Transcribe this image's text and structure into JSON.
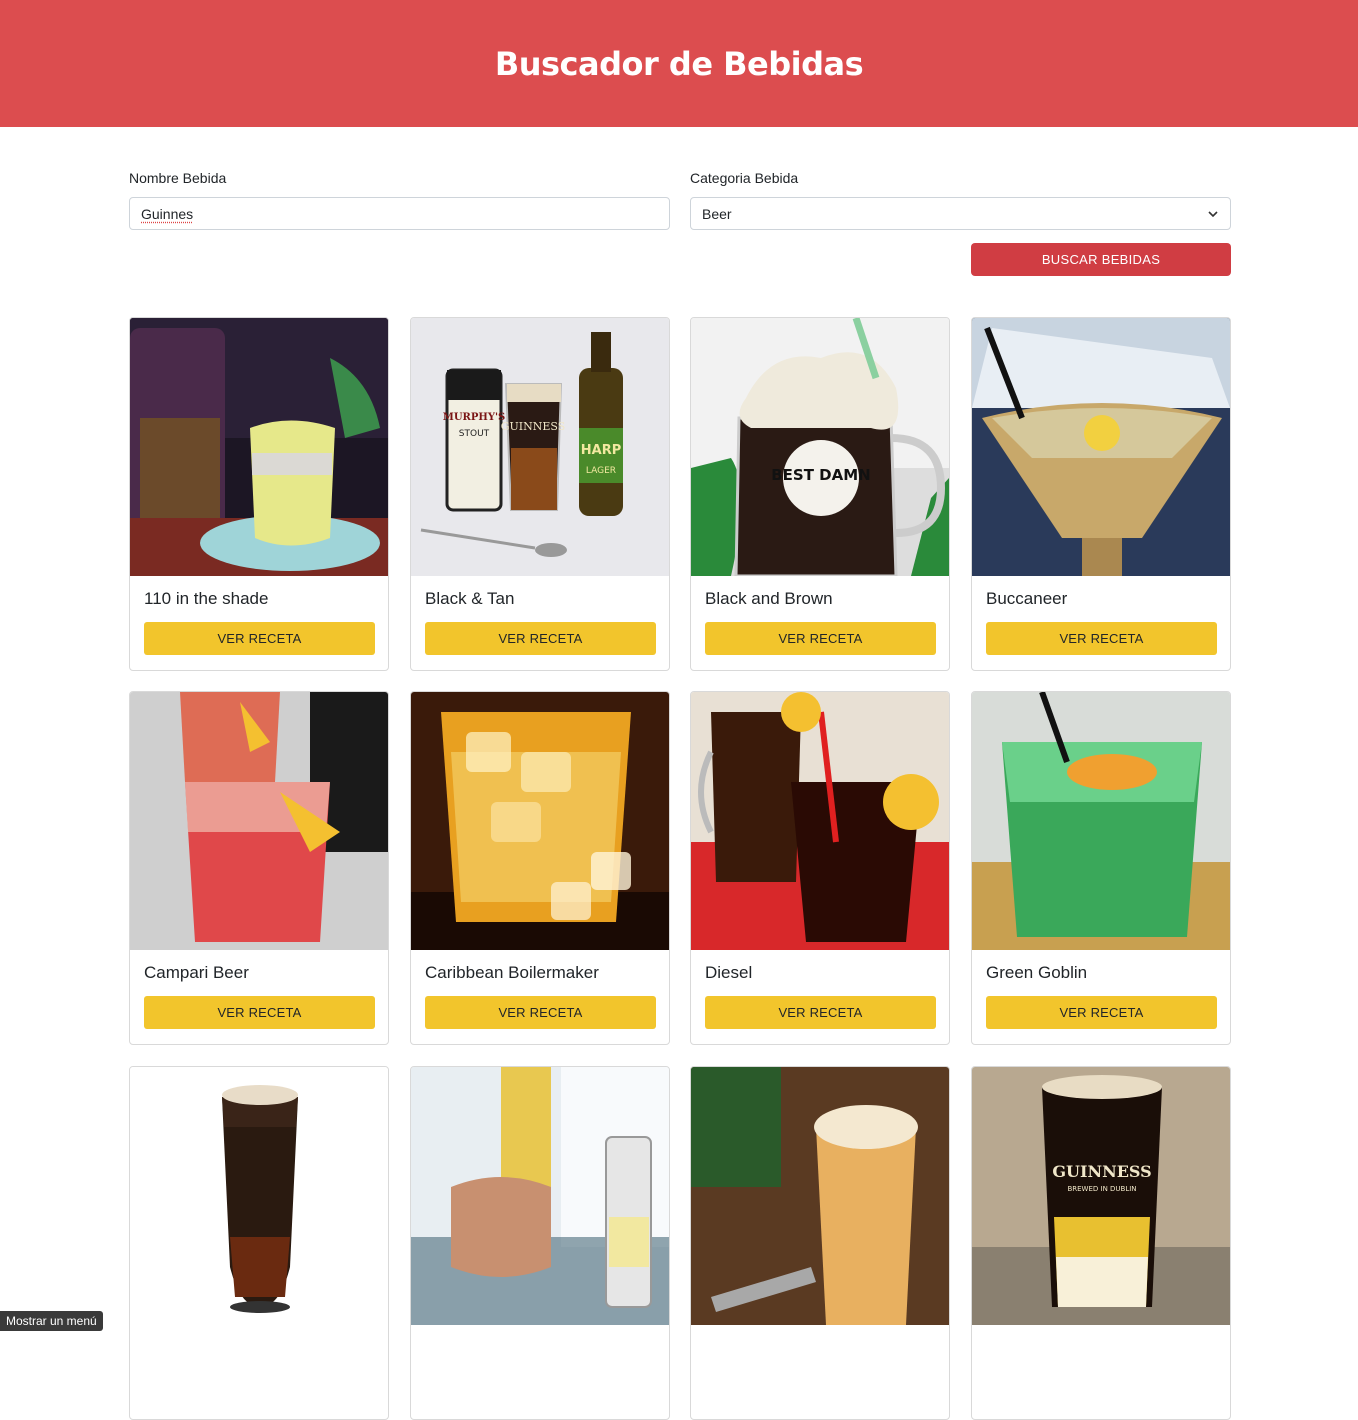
{
  "header": {
    "title": "Buscador de Bebidas"
  },
  "form": {
    "name_label": "Nombre Bebida",
    "name_value": "Guinnes",
    "category_label": "Categoria Bebida",
    "category_value": "Beer",
    "search_button": "Buscar Bebidas"
  },
  "drinks": [
    {
      "name": "110 in the shade",
      "button": "VER RECETA"
    },
    {
      "name": "Black & Tan",
      "button": "VER RECETA"
    },
    {
      "name": "Black and Brown",
      "button": "VER RECETA"
    },
    {
      "name": "Buccaneer",
      "button": "VER RECETA"
    },
    {
      "name": "Campari Beer",
      "button": "VER RECETA"
    },
    {
      "name": "Caribbean Boilermaker",
      "button": "VER RECETA"
    },
    {
      "name": "Diesel",
      "button": "VER RECETA"
    },
    {
      "name": "Green Goblin",
      "button": "VER RECETA"
    },
    {
      "name": "",
      "button": ""
    },
    {
      "name": "",
      "button": ""
    },
    {
      "name": "",
      "button": ""
    },
    {
      "name": "",
      "button": ""
    }
  ],
  "image_labels": {
    "guinness": "GUINNESS",
    "murphys": "MURPHY'S",
    "stout": "STOUT",
    "harp": "HARP",
    "lager": "LAGER",
    "best_damn": "BEST DAMN",
    "brewed": "BREWED IN DUBLIN"
  },
  "tooltip": "Mostrar un menú",
  "colors": {
    "header": "#dc4d4f",
    "search_button": "#d03d43",
    "card_button": "#f2c52c"
  }
}
